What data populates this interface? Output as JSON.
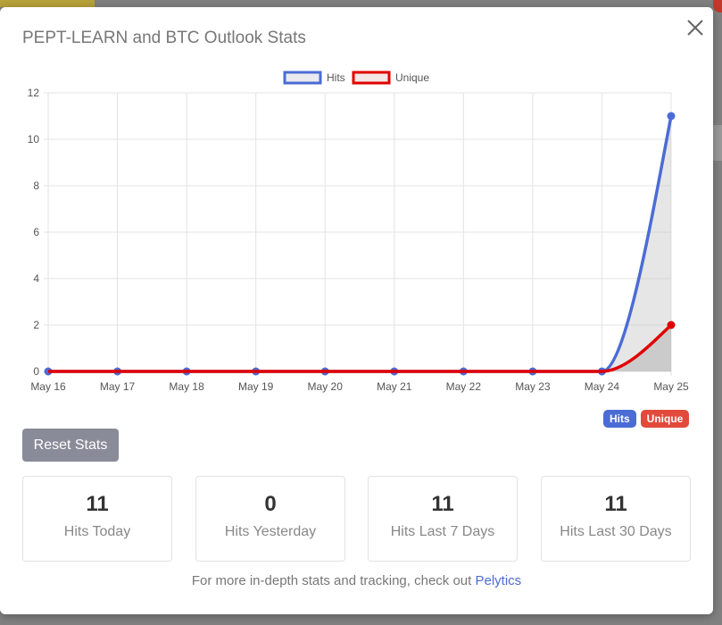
{
  "modal": {
    "title": "PEPT-LEARN and BTC Outlook Stats",
    "close_icon": "close-icon"
  },
  "chart_data": {
    "type": "line",
    "categories": [
      "May 16",
      "May 17",
      "May 18",
      "May 19",
      "May 20",
      "May 21",
      "May 22",
      "May 23",
      "May 24",
      "May 25"
    ],
    "series": [
      {
        "name": "Hits",
        "values": [
          0,
          0,
          0,
          0,
          0,
          0,
          0,
          0,
          0,
          11
        ],
        "color": "#4b6cd5"
      },
      {
        "name": "Unique",
        "values": [
          0,
          0,
          0,
          0,
          0,
          0,
          0,
          0,
          0,
          2
        ],
        "color": "#e00000"
      }
    ],
    "y_ticks": [
      "0",
      "2",
      "4",
      "6",
      "8",
      "10",
      "12"
    ],
    "ylim": [
      0,
      12
    ],
    "grid": true,
    "legend_position": "top"
  },
  "badges": {
    "hits": "Hits",
    "unique": "Unique"
  },
  "reset_label": "Reset Stats",
  "stats": [
    {
      "value": "11",
      "label": "Hits Today"
    },
    {
      "value": "0",
      "label": "Hits Yesterday"
    },
    {
      "value": "11",
      "label": "Hits Last 7 Days"
    },
    {
      "value": "11",
      "label": "Hits Last 30 Days"
    }
  ],
  "footer": {
    "text": "For more in-depth stats and tracking, check out ",
    "link": "Pelytics"
  }
}
